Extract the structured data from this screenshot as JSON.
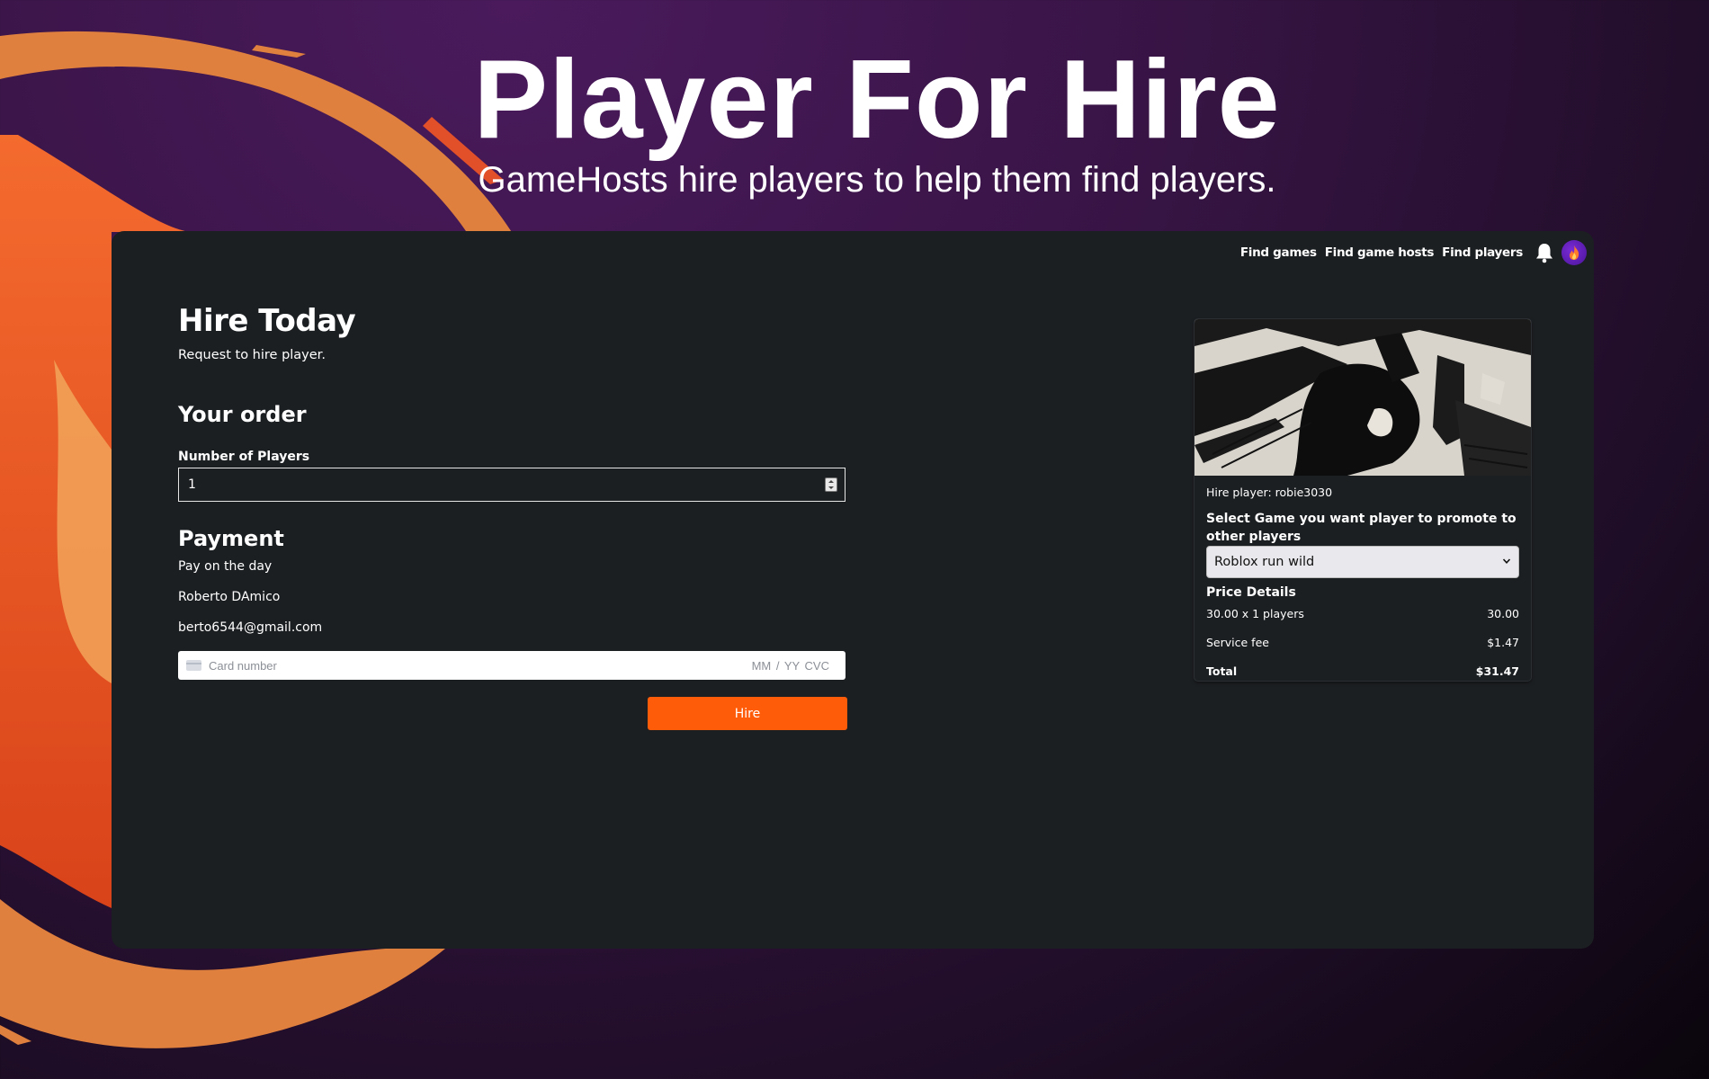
{
  "hero": {
    "title": "Player For Hire",
    "subtitle": "GameHosts hire players to help them find players."
  },
  "nav": {
    "links": [
      "Find games",
      "Find game hosts",
      "Find players"
    ],
    "icons": [
      "bell-icon",
      "flame-icon"
    ]
  },
  "form": {
    "heading": "Hire Today",
    "subheading": "Request to hire player.",
    "order_heading": "Your order",
    "players_label": "Number of Players",
    "players_value": "1",
    "payment_heading": "Payment",
    "payment_note": "Pay on the day",
    "name": "Roberto DAmico",
    "email": "berto6544@gmail.com",
    "card_placeholder": "Card number",
    "card_right": "MM / YY  CVC",
    "hire_label": "Hire"
  },
  "summary": {
    "hire_player": "Hire player: robie3030",
    "select_title": "Select Game you want player to promote to other players",
    "selected_game": "Roblox run wild",
    "price_details_title": "Price Details",
    "rows": [
      {
        "label": "30.00 x 1 players",
        "value": "30.00"
      },
      {
        "label": "Service fee",
        "value": "$1.47"
      },
      {
        "label": "Total",
        "value": "$31.47"
      }
    ]
  },
  "colors": {
    "accent": "#ff5c0a",
    "panel": "#1c1f22",
    "avatar": "#6a22c4"
  }
}
